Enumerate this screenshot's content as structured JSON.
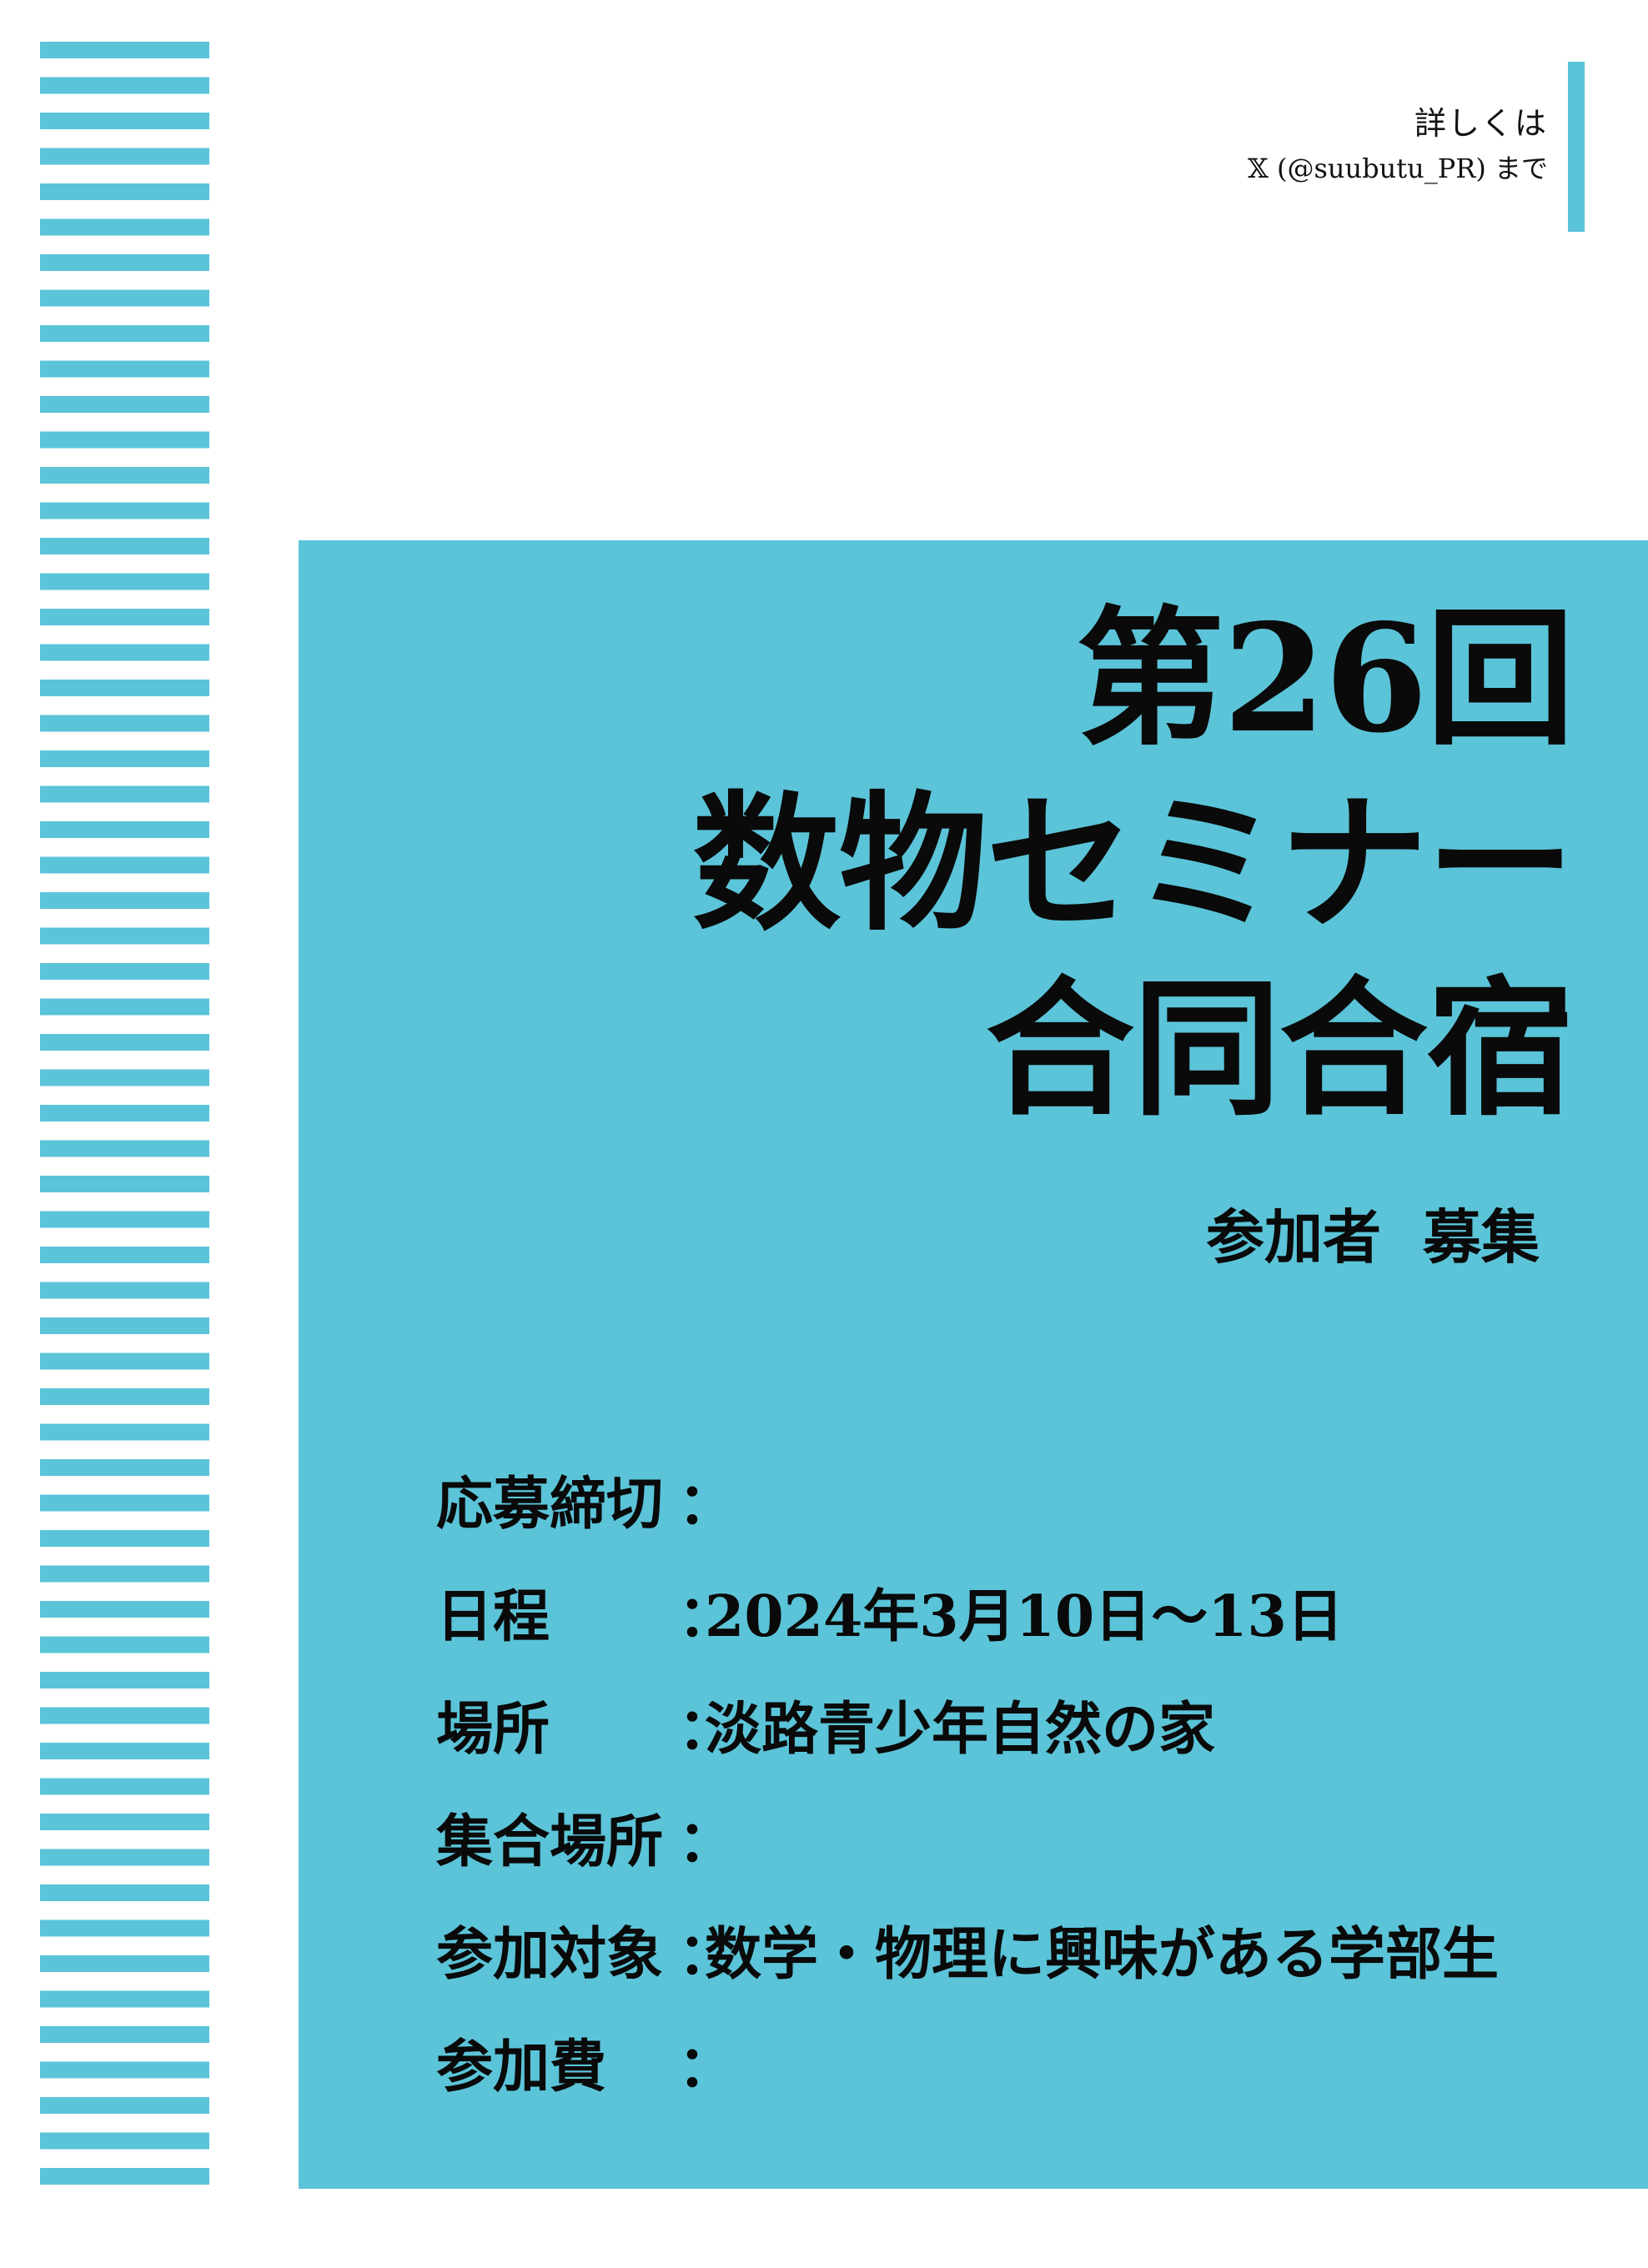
{
  "colors": {
    "accent": "#5BC4D8",
    "text": "#0a0a0a",
    "background": "#ffffff"
  },
  "contact": {
    "line1": "詳しくは",
    "line2": "𝕏 (@suubutu_PR) まで"
  },
  "title": {
    "line1": "第26回",
    "line2": "数物セミナー",
    "line3": "合同合宿"
  },
  "subtitle": {
    "part1": "参加者",
    "part2": "募集"
  },
  "details": [
    {
      "label": "応募締切",
      "colon": "：",
      "value": ""
    },
    {
      "label": "日程",
      "colon": "：",
      "value": "2024年3月10日～13日"
    },
    {
      "label": "場所",
      "colon": "：",
      "value": "淡路青少年自然の家"
    },
    {
      "label": "集合場所",
      "colon": "：",
      "value": ""
    },
    {
      "label": "参加対象",
      "colon": "：",
      "value": "数学・物理に興味がある学部生"
    },
    {
      "label": "参加費",
      "colon": "：",
      "value": ""
    }
  ]
}
